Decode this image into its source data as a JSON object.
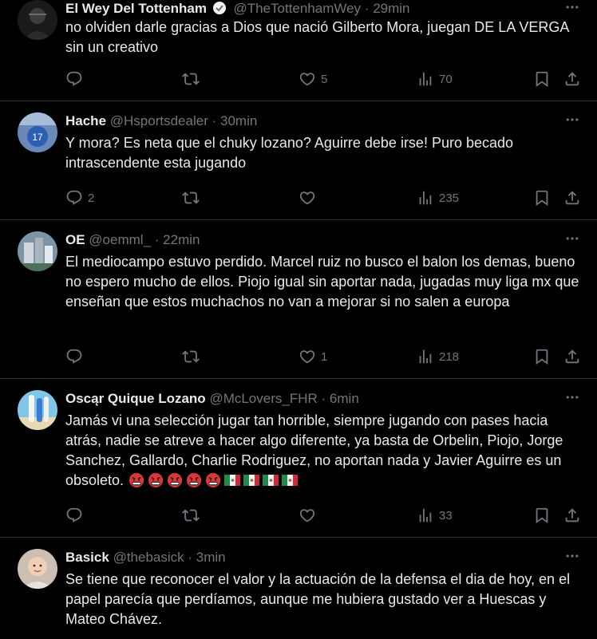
{
  "tweets": [
    {
      "name": "El Wey Del Tottenham",
      "handle": "@TheTottenhamWey",
      "time": "29min",
      "text": "no olviden darle gracias a Dios que nació Gilberto Mora, juegan DE LA VERGA sin un creativo",
      "replies": "",
      "likes": "5",
      "views": "70"
    },
    {
      "name": "Hache",
      "handle": "@Hsportsdealer",
      "time": "30min",
      "text": "Y mora? Es neta que el chuky lozano? Aguirre debe irse! Puro becado intrascendente esta jugando",
      "replies": "2",
      "likes": "",
      "views": "235"
    },
    {
      "name": "OE",
      "handle": "@oemml_",
      "time": "22min",
      "text": "El mediocampo estuvo perdido. Marcel ruiz no busco el balon los demas, bueno no espero mucho de ellos. Piojo igual sin aportar nada, jugadas muy liga mx que enseñan que estos muchachos no van a mejorar si no salen a europa",
      "replies": "",
      "likes": "1",
      "views": "218"
    },
    {
      "name": "Oscąr Quique Lozano",
      "handle": "@McLovers_FHR",
      "time": "6min",
      "text": "Jamás vi una selección jugar tan horrible, siempre jugando con pases hacia atrás, nadie se atreve a hacer algo diferente, ya basta de Orbelin, Piojo, Jorge Sanchez, Gallardo, Charlie Rodriguez, no aportan nada y Javier Aguirre es un obsoleto.",
      "replies": "",
      "likes": "",
      "views": "33"
    },
    {
      "name": "Basick",
      "handle": "@thebasick",
      "time": "3min",
      "text": "Se tiene que reconocer el valor y la actuación de la defensa el dia de hoy, en el papel parecía que perdíamos, aunque me hubiera gustado ver a Huescas y Mateo Chávez.",
      "replies": "",
      "likes": "",
      "views": ""
    }
  ],
  "separator": "·",
  "icons": {
    "more": "more-icon",
    "reply": "reply-icon",
    "retweet": "retweet-icon",
    "like": "like-icon",
    "views": "views-icon",
    "bookmark": "bookmark-icon",
    "share": "share-icon",
    "verified": "verified-badge-icon",
    "angry": "angry-face-emoji",
    "flag": "mexico-flag-emoji"
  },
  "colors": {
    "background": "#000000",
    "text": "#e7e9ea",
    "muted": "#71767b",
    "border": "#2f3336"
  }
}
